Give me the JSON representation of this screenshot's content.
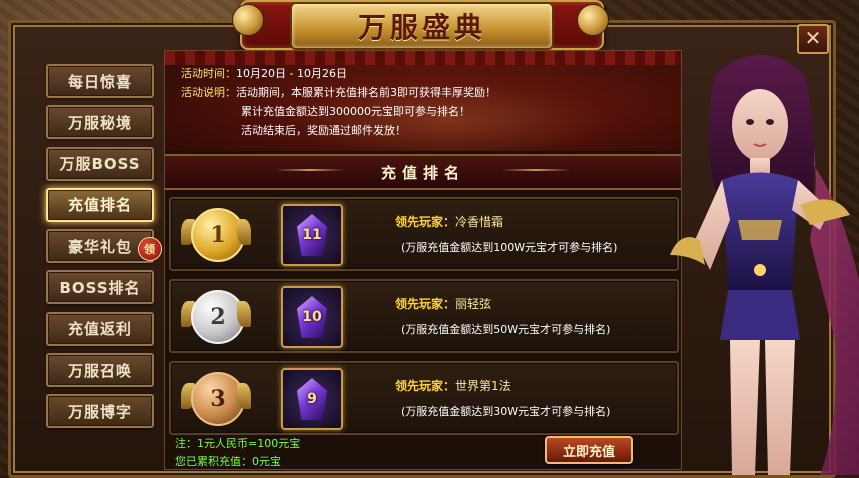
{
  "window": {
    "title": "万服盛典",
    "close_label": "✕"
  },
  "sidebar": {
    "items": [
      {
        "label": "每日惊喜",
        "active": false
      },
      {
        "label": "万服秘境",
        "active": false
      },
      {
        "label": "万服BOSS",
        "active": false
      },
      {
        "label": "充值排名",
        "active": true
      },
      {
        "label": "豪华礼包",
        "active": false,
        "badge": "领"
      },
      {
        "label": "BOSS排名",
        "active": false
      },
      {
        "label": "充值返利",
        "active": false
      },
      {
        "label": "万服召唤",
        "active": false
      },
      {
        "label": "万服博字",
        "active": false
      }
    ]
  },
  "info": {
    "time_label": "活动时间：",
    "time_value": "10月20日 - 10月26日",
    "desc_label": "活动说明：",
    "desc_line1": "活动期间，本服累计充值排名前3即可获得丰厚奖励！",
    "desc_line2": "累计充值金额达到300000元宝即可参与排名！",
    "desc_line3": "活动结束后，奖励通过邮件发放！"
  },
  "ranking": {
    "header": "充值排名",
    "rows": [
      {
        "rank": "1",
        "item_level": "11",
        "leader_label": "领先玩家：",
        "leader_name": "冷香惜霜",
        "requirement": "(万服充值金额达到100W元宝才可参与排名)"
      },
      {
        "rank": "2",
        "item_level": "10",
        "leader_label": "领先玩家：",
        "leader_name": "丽轻弦",
        "requirement": "(万服充值金额达到50W元宝才可参与排名)"
      },
      {
        "rank": "3",
        "item_level": "9",
        "leader_label": "领先玩家：",
        "leader_name": "世界第1法",
        "requirement": "(万服充值金额达到30W元宝才可参与排名)"
      }
    ]
  },
  "footer": {
    "note": "注：1元人民币=100元宝",
    "accumulated": "您已累积充值：0元宝",
    "recharge_button": "立即充值"
  },
  "colors": {
    "accent_gold": "#c99a4a",
    "highlight_yellow": "#ffd236",
    "note_green": "#7aff3a",
    "banner_red": "#8a1510"
  }
}
